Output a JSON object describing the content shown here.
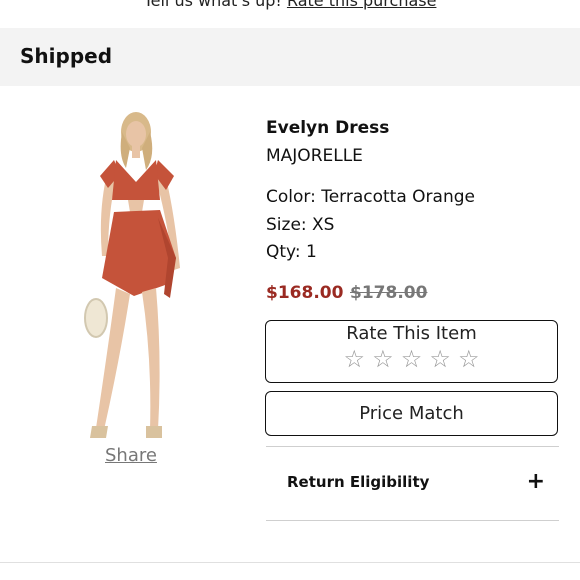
{
  "banner": {
    "text": "Tell us what's up!",
    "link": "Rate this purchase"
  },
  "order": {
    "status": "Shipped"
  },
  "product": {
    "name": "Evelyn Dress",
    "brand": "MAJORELLE",
    "color": "Color: Terracotta Orange",
    "size": "Size: XS",
    "qty": "Qty: 1",
    "sale_price": "$168.00",
    "original_price": "$178.00",
    "share": "Share"
  },
  "actions": {
    "rate_label": "Rate This Item",
    "rating_max": 5,
    "price_match_label": "Price Match"
  },
  "accordion": {
    "return_label": "Return Eligibility",
    "toggle_glyph": "+"
  },
  "colors": {
    "sale_price": "#9a2a22",
    "dress": "#c5533a",
    "status_bg": "#f3f3f3"
  }
}
